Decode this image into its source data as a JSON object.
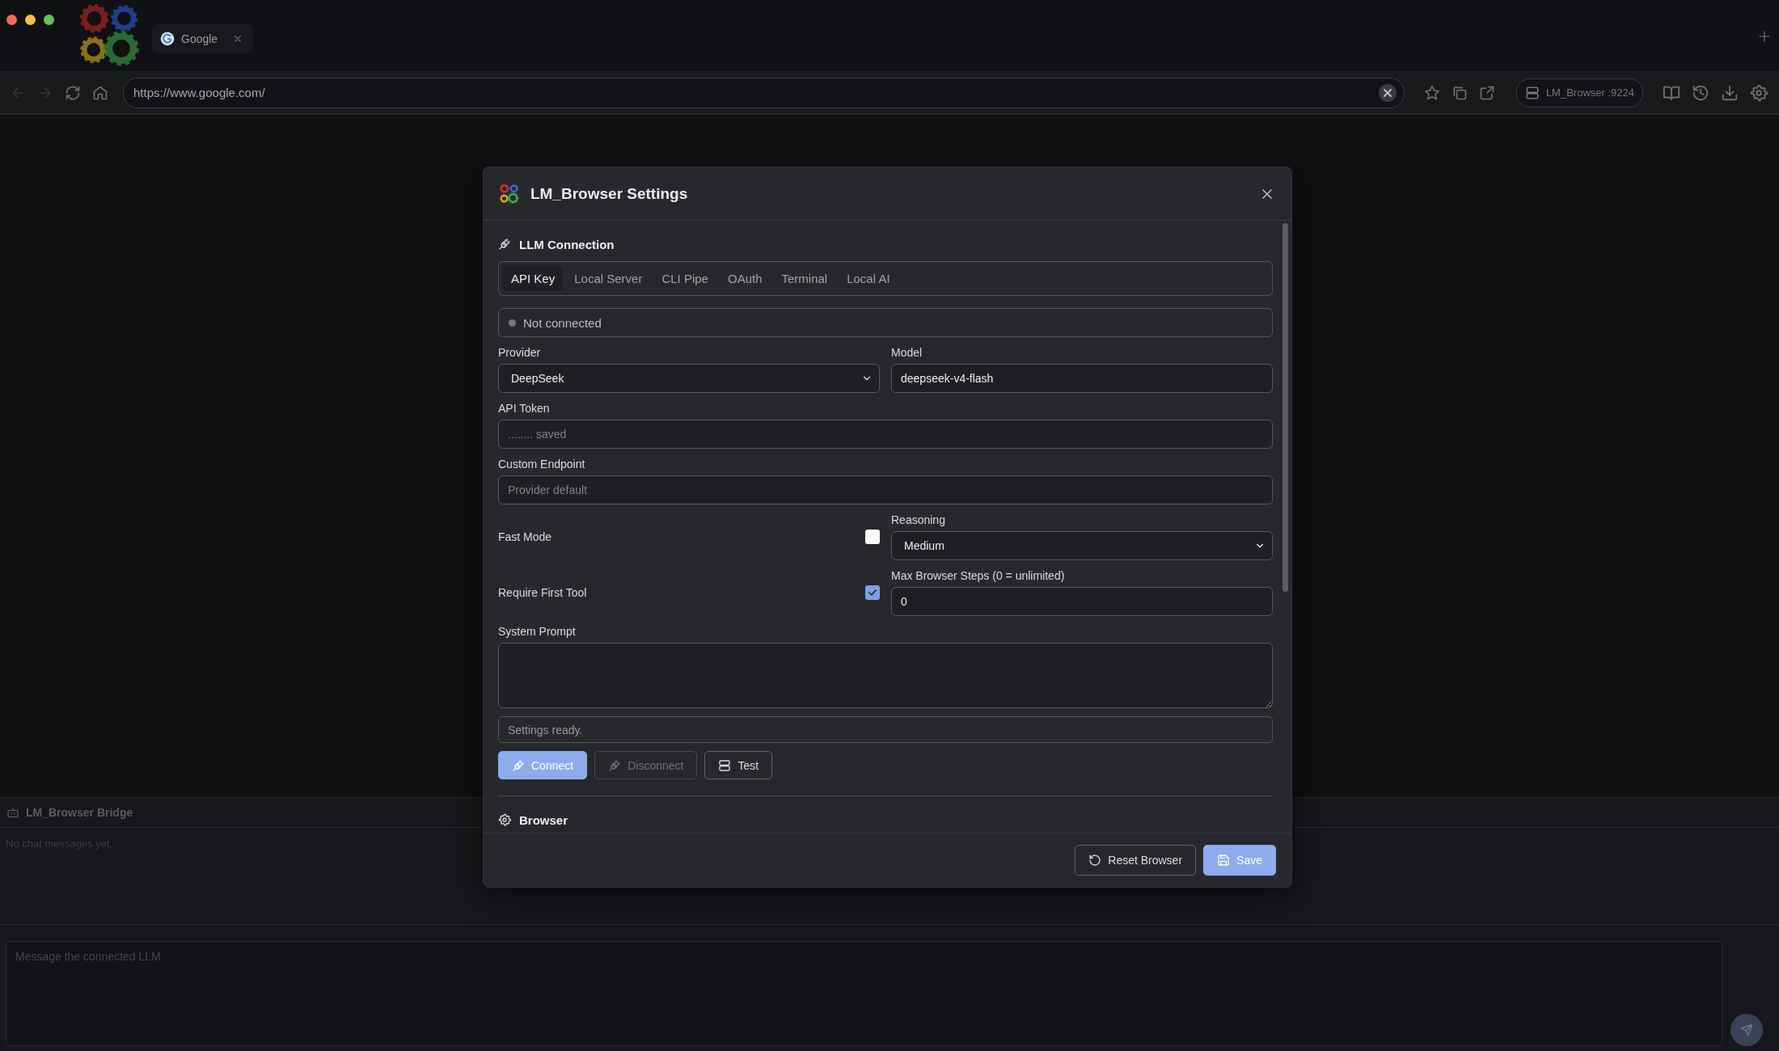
{
  "tabs": [
    {
      "label": "Google",
      "selected": true
    }
  ],
  "toolbar": {
    "url": "https://www.google.com/",
    "bridge_badge": "LM_Browser :9224"
  },
  "bridge": {
    "title": "LM_Browser Bridge",
    "empty_text": "No chat messages yet.",
    "input": {
      "placeholder": "Message the connected LLM"
    }
  },
  "dialog": {
    "title": "LM_Browser Settings",
    "section_title": "LLM Connection",
    "connection_tabs": [
      {
        "label": "API Key",
        "selected": true
      },
      {
        "label": "Local Server",
        "selected": false
      },
      {
        "label": "CLI Pipe",
        "selected": false
      },
      {
        "label": "OAuth",
        "selected": false
      },
      {
        "label": "Terminal",
        "selected": false
      },
      {
        "label": "Local AI",
        "selected": false
      }
    ],
    "status": {
      "text": "Not connected",
      "connected": false
    },
    "provider": {
      "label": "Provider",
      "value": "DeepSeek"
    },
    "model": {
      "label": "Model",
      "value": "deepseek-v4-flash"
    },
    "api_token": {
      "label": "API Token",
      "placeholder": "........ saved"
    },
    "custom_endpoint": {
      "label": "Custom Endpoint",
      "placeholder": "Provider default"
    },
    "fast_mode": {
      "label": "Fast Mode",
      "checked": false
    },
    "reasoning": {
      "label": "Reasoning",
      "value": "Medium"
    },
    "require_first_tool": {
      "label": "Require First Tool",
      "checked": true
    },
    "max_steps": {
      "label": "Max Browser Steps (0 = unlimited)",
      "value": "0"
    },
    "system_prompt": {
      "label": "System Prompt"
    },
    "status_message": "Settings ready.",
    "actions": [
      {
        "label": "Connect",
        "primary": true,
        "disabled": false
      },
      {
        "label": "Disconnect",
        "primary": false,
        "disabled": true
      },
      {
        "label": "Test",
        "primary": false,
        "disabled": false
      }
    ],
    "next_section_title": "Browser",
    "footer_buttons": [
      {
        "label": "Reset Browser",
        "primary": false
      },
      {
        "label": "Save",
        "primary": true
      }
    ]
  }
}
